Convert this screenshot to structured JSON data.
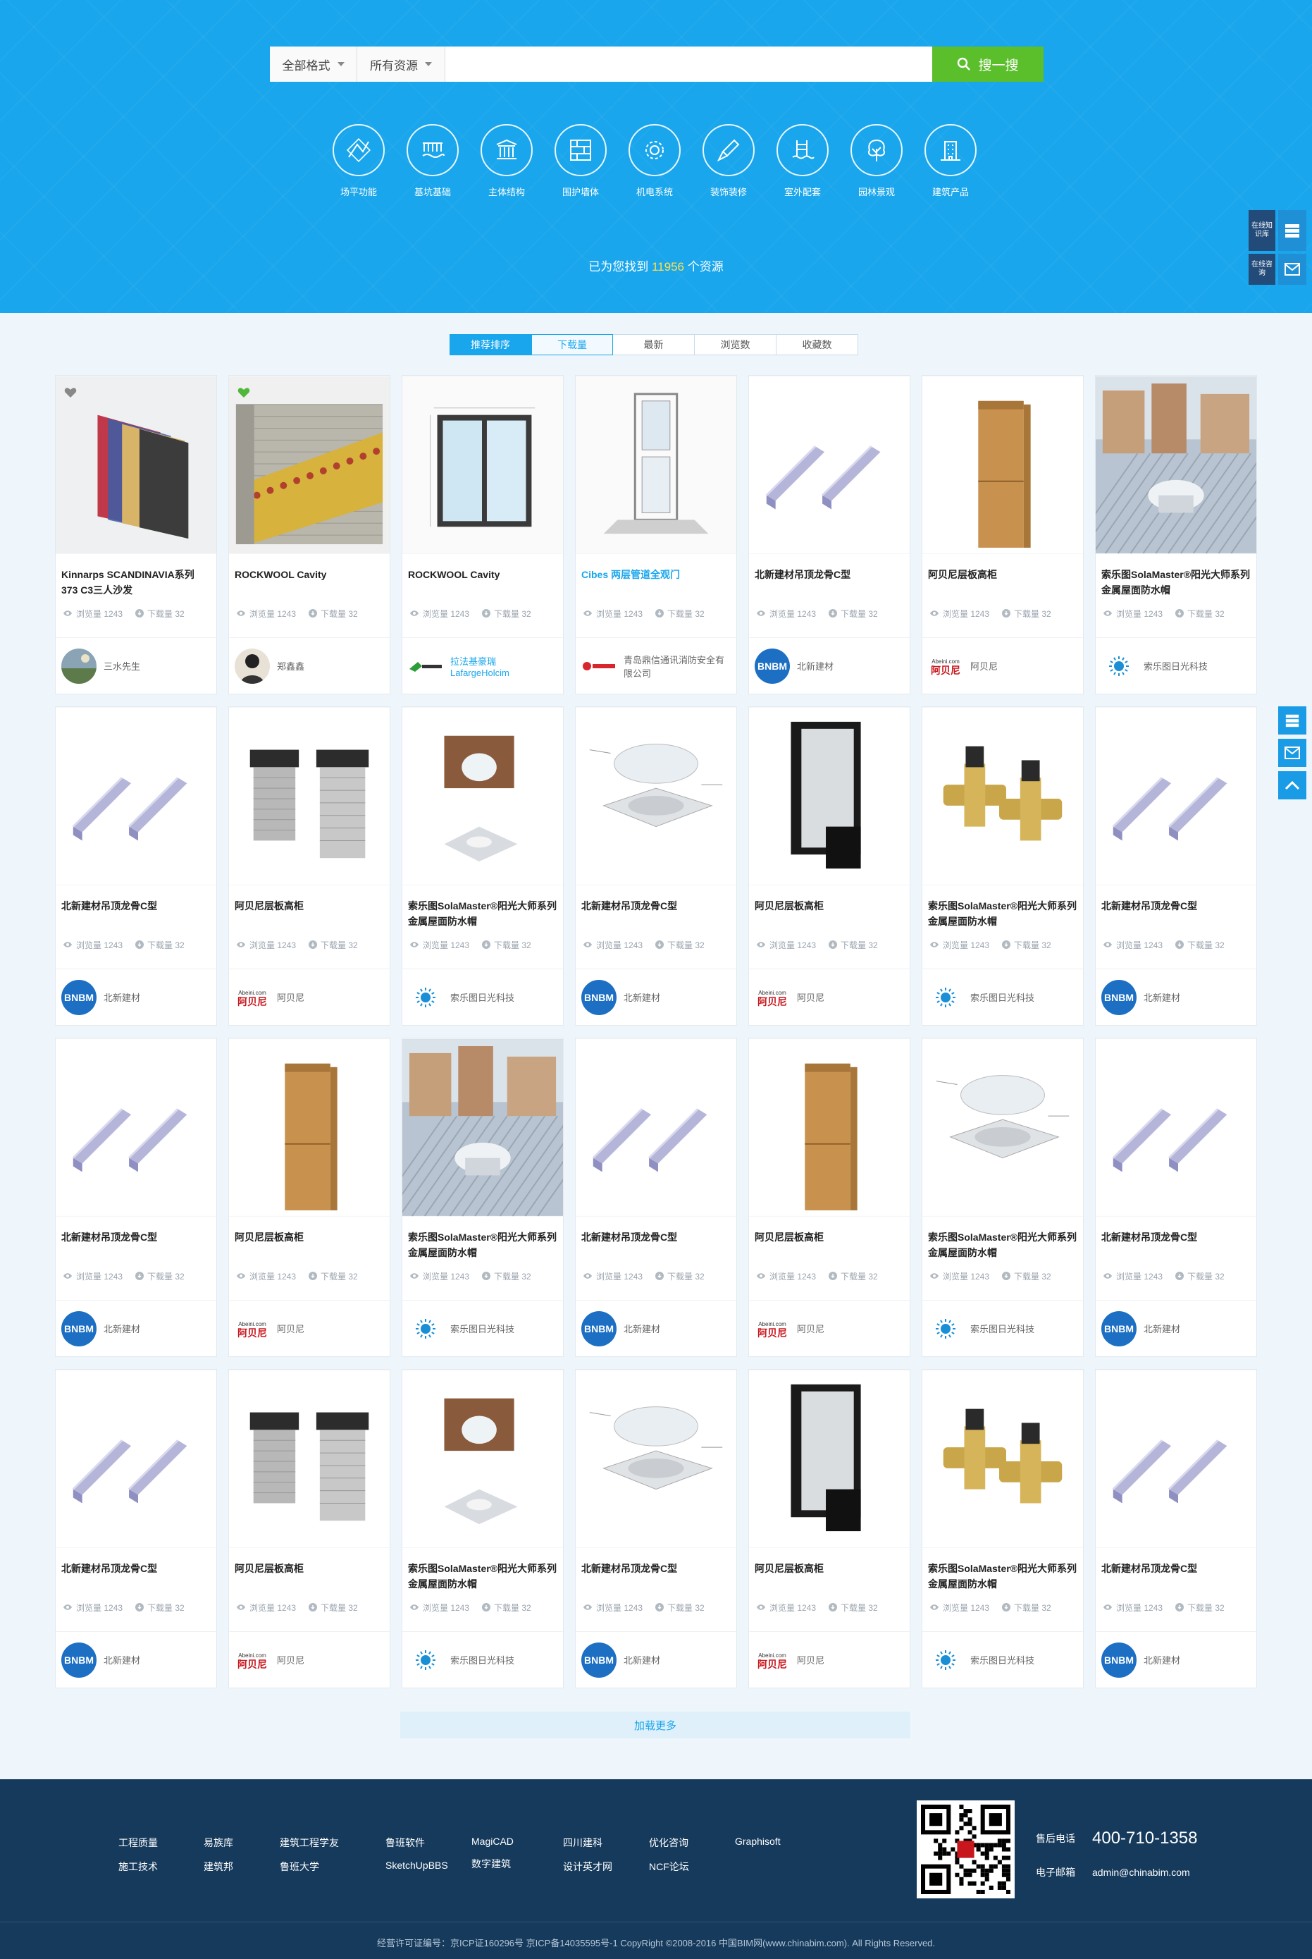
{
  "search": {
    "format_select": "全部格式",
    "resource_select": "所有资源",
    "query": "",
    "button_label": "搜一搜"
  },
  "categories": [
    {
      "label": "场平功能",
      "icon": "terrain-icon"
    },
    {
      "label": "基坑基础",
      "icon": "foundation-icon"
    },
    {
      "label": "主体结构",
      "icon": "structure-columns-icon"
    },
    {
      "label": "围护墙体",
      "icon": "wall-icon"
    },
    {
      "label": "机电系统",
      "icon": "gear-icon"
    },
    {
      "label": "装饰装修",
      "icon": "brush-icon"
    },
    {
      "label": "室外配套",
      "icon": "pool-icon"
    },
    {
      "label": "园林景观",
      "icon": "tree-icon"
    },
    {
      "label": "建筑产品",
      "icon": "building-icon"
    }
  ],
  "result": {
    "prefix": "已为您找到",
    "count": "11956",
    "suffix": "个资源"
  },
  "side_panel": {
    "knowledge_label": "在线知识库",
    "consult_label": "在线咨询"
  },
  "sort_tabs": [
    "推荐排序",
    "下载量",
    "最新",
    "浏览数",
    "收藏数"
  ],
  "stats": {
    "views_label": "浏览量 1243",
    "downloads_label": "下载量 32"
  },
  "cards": [
    {
      "title": "Kinnarps SCANDINAVIA系列373 C3三人沙发",
      "img": "wallpanel",
      "owner": "三水先生",
      "logo": "photo",
      "fav": "gray"
    },
    {
      "title": "ROCKWOOL Cavity",
      "img": "rockwool",
      "owner": "郑鑫鑫",
      "logo": "person",
      "fav": "green"
    },
    {
      "title": "ROCKWOOL Cavity",
      "img": "window",
      "owner": "拉法基豪瑞 LafargeHolcim",
      "logo": "lafarge",
      "owner_link": true
    },
    {
      "title": "Cibes 两层管道全观门",
      "img": "elevator",
      "owner": "青岛鼎信通讯消防安全有限公司",
      "logo": "topscomm",
      "title_link": true
    },
    {
      "title": "北新建材吊顶龙骨C型",
      "img": "keel",
      "owner": "北新建材",
      "logo": "bnbm"
    },
    {
      "title": "阿贝尼层板高柜",
      "img": "cabinet",
      "owner": "阿贝尼",
      "logo": "abeini"
    },
    {
      "title": "索乐图SolaMaster®阳光大师系列金属屋面防水帽",
      "img": "roof",
      "owner": "索乐图日光科技",
      "logo": "sun"
    },
    {
      "title": "北新建材吊顶龙骨C型",
      "img": "keel",
      "owner": "北新建材",
      "logo": "bnbm"
    },
    {
      "title": "阿贝尼层板高柜",
      "img": "tubes",
      "owner": "阿贝尼",
      "logo": "abeini"
    },
    {
      "title": "索乐图SolaMaster®阳光大师系列金属屋面防水帽",
      "img": "skylight",
      "owner": "索乐图日光科技",
      "logo": "sun"
    },
    {
      "title": "北新建材吊顶龙骨C型",
      "img": "dome",
      "owner": "北新建材",
      "logo": "bnbm"
    },
    {
      "title": "阿贝尼层板高柜",
      "img": "frame",
      "owner": "阿贝尼",
      "logo": "abeini"
    },
    {
      "title": "索乐图SolaMaster®阳光大师系列金属屋面防水帽",
      "img": "valves",
      "owner": "索乐图日光科技",
      "logo": "sun"
    },
    {
      "title": "北新建材吊顶龙骨C型",
      "img": "keel",
      "owner": "北新建材",
      "logo": "bnbm"
    },
    {
      "title": "北新建材吊顶龙骨C型",
      "img": "keel",
      "owner": "北新建材",
      "logo": "bnbm"
    },
    {
      "title": "阿贝尼层板高柜",
      "img": "cabinet",
      "owner": "阿贝尼",
      "logo": "abeini"
    },
    {
      "title": "索乐图SolaMaster®阳光大师系列金属屋面防水帽",
      "img": "roof",
      "owner": "索乐图日光科技",
      "logo": "sun"
    },
    {
      "title": "北新建材吊顶龙骨C型",
      "img": "keel",
      "owner": "北新建材",
      "logo": "bnbm"
    },
    {
      "title": "阿贝尼层板高柜",
      "img": "cabinet",
      "owner": "阿贝尼",
      "logo": "abeini"
    },
    {
      "title": "索乐图SolaMaster®阳光大师系列金属屋面防水帽",
      "img": "dome",
      "owner": "索乐图日光科技",
      "logo": "sun"
    },
    {
      "title": "北新建材吊顶龙骨C型",
      "img": "keel",
      "owner": "北新建材",
      "logo": "bnbm"
    },
    {
      "title": "北新建材吊顶龙骨C型",
      "img": "keel",
      "owner": "北新建材",
      "logo": "bnbm"
    },
    {
      "title": "阿贝尼层板高柜",
      "img": "tubes",
      "owner": "阿贝尼",
      "logo": "abeini"
    },
    {
      "title": "索乐图SolaMaster®阳光大师系列金属屋面防水帽",
      "img": "skylight",
      "owner": "索乐图日光科技",
      "logo": "sun"
    },
    {
      "title": "北新建材吊顶龙骨C型",
      "img": "dome",
      "owner": "北新建材",
      "logo": "bnbm"
    },
    {
      "title": "阿贝尼层板高柜",
      "img": "frame",
      "owner": "阿贝尼",
      "logo": "abeini"
    },
    {
      "title": "索乐图SolaMaster®阳光大师系列金属屋面防水帽",
      "img": "valves",
      "owner": "索乐图日光科技",
      "logo": "sun"
    },
    {
      "title": "北新建材吊顶龙骨C型",
      "img": "keel",
      "owner": "北新建材",
      "logo": "bnbm"
    }
  ],
  "load_more": "加载更多",
  "footer": {
    "link_columns": [
      [
        "工程质量",
        "施工技术"
      ],
      [
        "易族库",
        "建筑邦"
      ],
      [
        "建筑工程学友",
        "鲁班大学"
      ],
      [
        "鲁班软件",
        "SketchUpBBS"
      ],
      [
        "MagiCAD",
        "数字建筑"
      ],
      [
        "四川建科",
        "设计英才网"
      ],
      [
        "优化咨询",
        "NCF论坛"
      ],
      [
        "Graphisoft"
      ]
    ],
    "phone_label": "售后电话",
    "phone": "400-710-1358",
    "email_label": "电子邮箱",
    "email": "admin@chinabim.com",
    "copyright": "经营许可证编号：京ICP证160296号    京ICP备14035595号-1    CopyRight ©2008-2016 中国BIM网(www.chinabim.com). All Rights Reserved."
  },
  "colors": {
    "primary": "#1aa6ec",
    "search_button": "#5bbe2b",
    "footer": "#163a5c",
    "highlight": "#ffe14d"
  }
}
